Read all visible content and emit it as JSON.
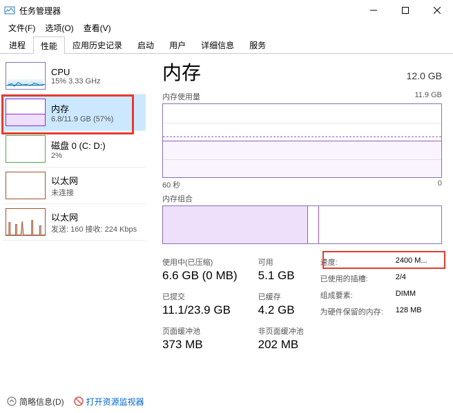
{
  "window": {
    "title": "任务管理器"
  },
  "menu": {
    "file": "文件(F)",
    "options": "选项(O)",
    "view": "查看(V)"
  },
  "tabs": [
    "进程",
    "性能",
    "应用历史记录",
    "启动",
    "用户",
    "详细信息",
    "服务"
  ],
  "active_tab": "性能",
  "sidebar": {
    "items": [
      {
        "title": "CPU",
        "sub": "15% 3.33 GHz"
      },
      {
        "title": "内存",
        "sub": "6.8/11.9 GB (57%)"
      },
      {
        "title": "磁盘 0 (C: D:)",
        "sub": "2%"
      },
      {
        "title": "以太网",
        "sub": "未连接"
      },
      {
        "title": "以太网",
        "sub": "发送: 160 接收: 224 Kbps"
      }
    ]
  },
  "content": {
    "title": "内存",
    "total": "12.0 GB",
    "usage_label": "内存使用量",
    "usage_max": "11.9 GB",
    "axis_left": "60 秒",
    "axis_right": "0",
    "composition_label": "内存组合",
    "stats": {
      "in_use_label": "使用中(已压缩)",
      "in_use_value": "6.6 GB (0 MB)",
      "available_label": "可用",
      "available_value": "5.1 GB",
      "committed_label": "已提交",
      "committed_value": "11.1/23.9 GB",
      "cached_label": "已缓存",
      "cached_value": "4.2 GB",
      "paged_label": "页面缓冲池",
      "paged_value": "373 MB",
      "nonpaged_label": "非页面缓冲池",
      "nonpaged_value": "202 MB"
    },
    "right": {
      "speed_label": "速度:",
      "speed_value": "2400 M...",
      "slots_label": "已使用的插槽:",
      "slots_value": "2/4",
      "form_label": "组成要素:",
      "form_value": "DIMM",
      "reserved_label": "为硬件保留的内存:",
      "reserved_value": "128 MB"
    }
  },
  "footer": {
    "brief": "简略信息(D)",
    "resmon": "打开资源监视器"
  }
}
